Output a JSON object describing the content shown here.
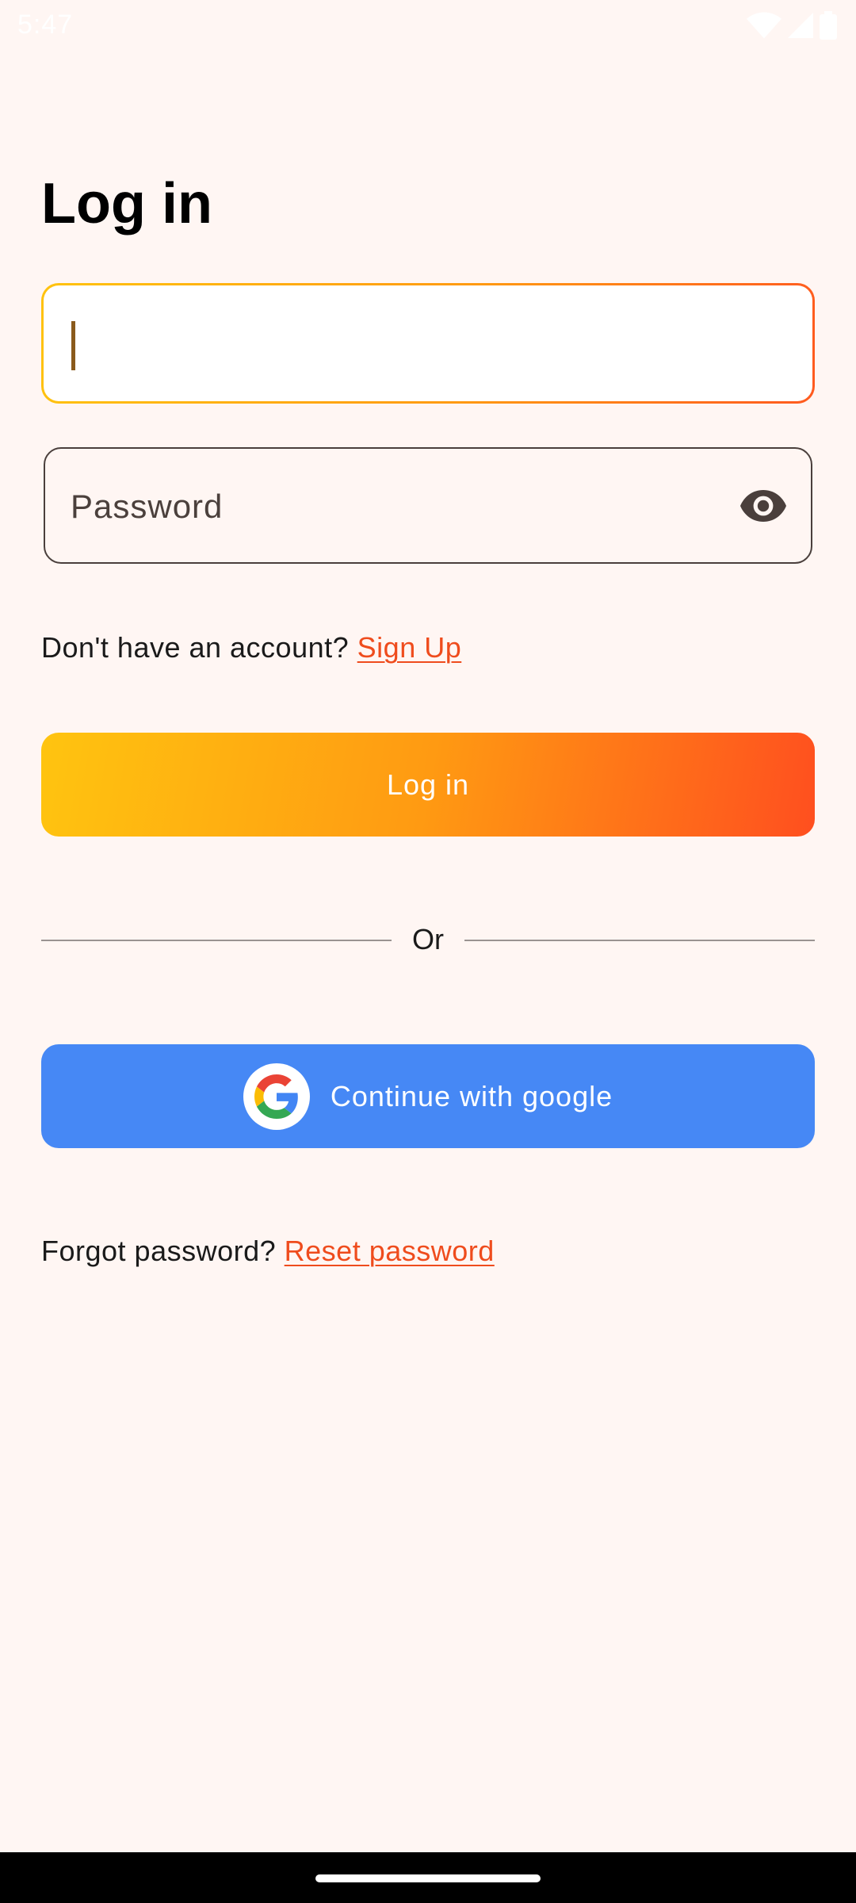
{
  "status_bar": {
    "time": "5:47",
    "icons": [
      "wifi-icon",
      "cellular-icon",
      "battery-icon"
    ]
  },
  "login": {
    "title": "Log in",
    "email": {
      "value": "",
      "placeholder": ""
    },
    "password": {
      "value": "",
      "placeholder": "Password",
      "toggle_icon": "eye-icon"
    },
    "signup_prompt": "Don't have an account?",
    "signup_link": "Sign Up",
    "login_button": "Log in",
    "divider_text": "Or",
    "google_button": "Continue with google",
    "google_icon": "google-logo-icon",
    "forgot_prompt": "Forgot password?",
    "reset_link": "Reset password"
  },
  "colors": {
    "background": "#fff6f3",
    "accent_gradient_start": "#ffc410",
    "accent_gradient_end": "#ff4f1f",
    "link": "#ef4c1d",
    "google_blue": "#4688f5"
  }
}
